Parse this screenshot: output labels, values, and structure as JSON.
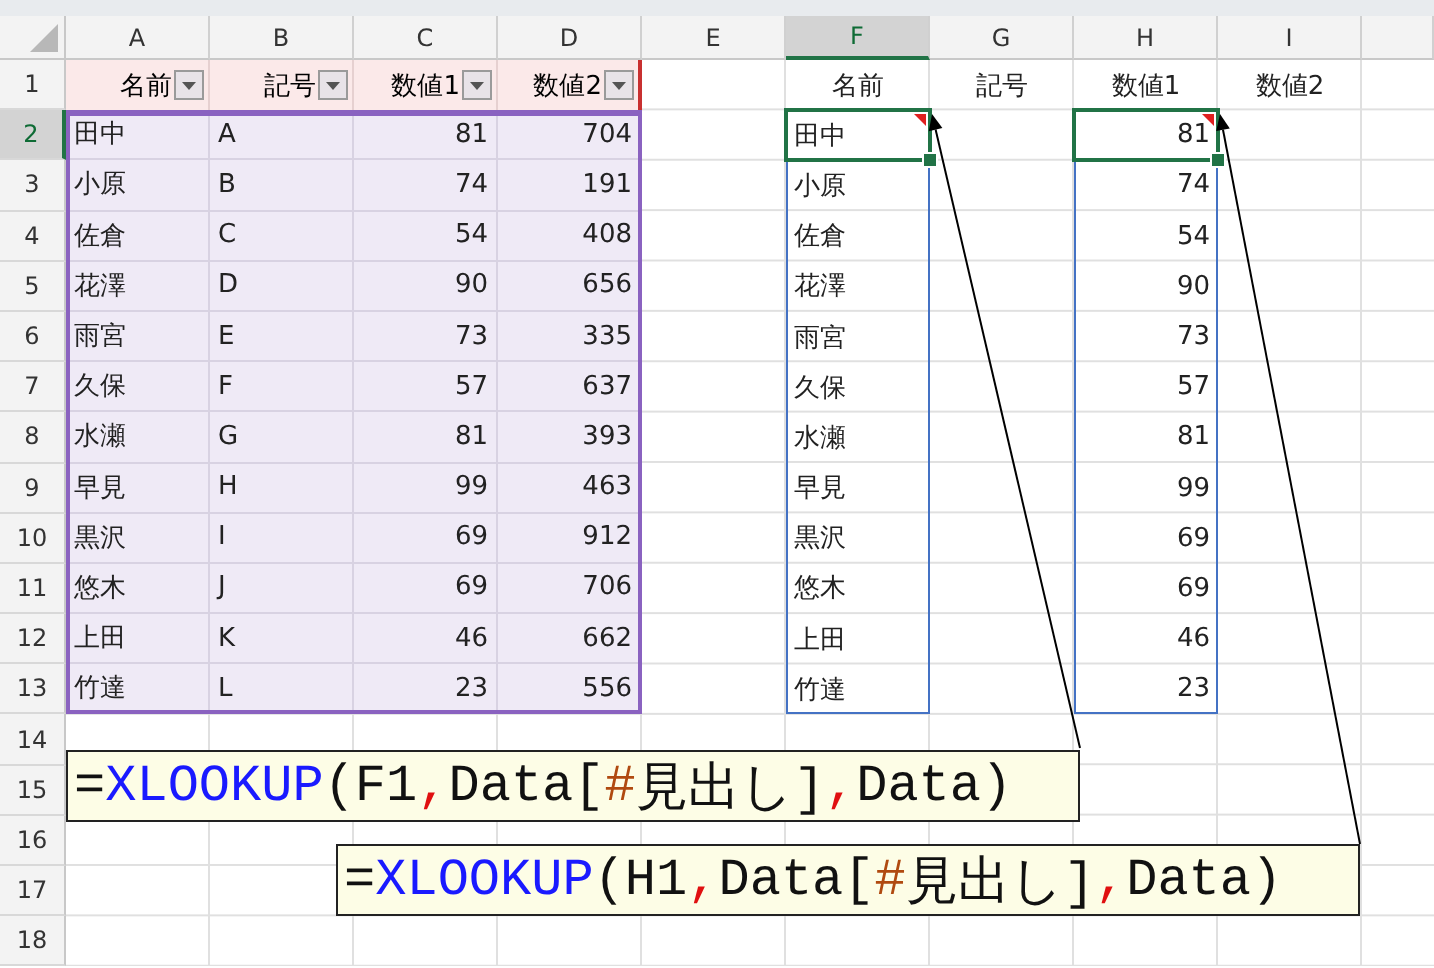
{
  "column_headers": [
    {
      "label": "A",
      "selected": false
    },
    {
      "label": "B",
      "selected": false
    },
    {
      "label": "C",
      "selected": false
    },
    {
      "label": "D",
      "selected": false
    },
    {
      "label": "E",
      "selected": false
    },
    {
      "label": "F",
      "selected": true
    },
    {
      "label": "G",
      "selected": false
    },
    {
      "label": "H",
      "selected": false
    },
    {
      "label": "I",
      "selected": false
    }
  ],
  "row_headers": [
    {
      "label": "1",
      "selected": false
    },
    {
      "label": "2",
      "selected": true
    },
    {
      "label": "3",
      "selected": false
    },
    {
      "label": "4",
      "selected": false
    },
    {
      "label": "5",
      "selected": false
    },
    {
      "label": "6",
      "selected": false
    },
    {
      "label": "7",
      "selected": false
    },
    {
      "label": "8",
      "selected": false
    },
    {
      "label": "9",
      "selected": false
    },
    {
      "label": "10",
      "selected": false
    },
    {
      "label": "11",
      "selected": false
    },
    {
      "label": "12",
      "selected": false
    },
    {
      "label": "13",
      "selected": false
    },
    {
      "label": "14",
      "selected": false
    },
    {
      "label": "15",
      "selected": false
    },
    {
      "label": "16",
      "selected": false
    },
    {
      "label": "17",
      "selected": false
    },
    {
      "label": "18",
      "selected": false
    }
  ],
  "table": {
    "columns": [
      "名前",
      "記号",
      "数値1",
      "数値2"
    ],
    "rows": [
      [
        "田中",
        "A",
        "81",
        "704"
      ],
      [
        "小原",
        "B",
        "74",
        "191"
      ],
      [
        "佐倉",
        "C",
        "54",
        "408"
      ],
      [
        "花澤",
        "D",
        "90",
        "656"
      ],
      [
        "雨宮",
        "E",
        "73",
        "335"
      ],
      [
        "久保",
        "F",
        "57",
        "637"
      ],
      [
        "水瀬",
        "G",
        "81",
        "393"
      ],
      [
        "早見",
        "H",
        "99",
        "463"
      ],
      [
        "黒沢",
        "I",
        "69",
        "912"
      ],
      [
        "悠木",
        "J",
        "69",
        "706"
      ],
      [
        "上田",
        "K",
        "46",
        "662"
      ],
      [
        "竹達",
        "L",
        "23",
        "556"
      ]
    ]
  },
  "right_headers": [
    "名前",
    "記号",
    "数値1",
    "数値2"
  ],
  "spill_ranges": [
    {
      "anchor_selected": true,
      "kind": "text",
      "values": [
        "田中",
        "小原",
        "佐倉",
        "花澤",
        "雨宮",
        "久保",
        "水瀬",
        "早見",
        "黒沢",
        "悠木",
        "上田",
        "竹達"
      ]
    },
    {
      "anchor_selected": true,
      "kind": "number",
      "values": [
        "81",
        "74",
        "54",
        "90",
        "73",
        "57",
        "81",
        "99",
        "69",
        "69",
        "46",
        "23"
      ]
    }
  ],
  "formulas": [
    {
      "parts": [
        {
          "kind": "text",
          "text": "="
        },
        {
          "kind": "function",
          "text": "XLOOKUP"
        },
        {
          "kind": "text",
          "text": "(F1"
        },
        {
          "kind": "separator",
          "text": ","
        },
        {
          "kind": "text",
          "text": "Data["
        },
        {
          "kind": "special",
          "text": "#"
        },
        {
          "kind": "text",
          "text": "見出し]"
        },
        {
          "kind": "separator",
          "text": ","
        },
        {
          "kind": "text",
          "text": "Data)"
        }
      ]
    },
    {
      "parts": [
        {
          "kind": "text",
          "text": "="
        },
        {
          "kind": "function",
          "text": "XLOOKUP"
        },
        {
          "kind": "text",
          "text": "(H1"
        },
        {
          "kind": "separator",
          "text": ","
        },
        {
          "kind": "text",
          "text": "Data["
        },
        {
          "kind": "special",
          "text": "#"
        },
        {
          "kind": "text",
          "text": "見出し]"
        },
        {
          "kind": "separator",
          "text": ","
        },
        {
          "kind": "text",
          "text": "Data)"
        }
      ]
    }
  ]
}
